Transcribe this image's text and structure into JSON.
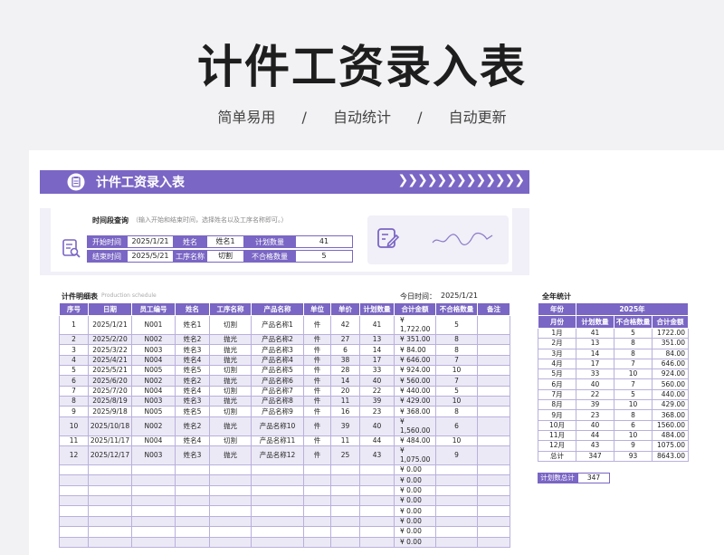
{
  "hero": {
    "title": "计件工资录入表",
    "sub": [
      "简单易用",
      "/",
      "自动统计",
      "/",
      "自动更新"
    ]
  },
  "banner": {
    "title": "计件工资录入表",
    "arrows": "❯❯❯❯❯❯❯❯❯❯❯❯❯"
  },
  "query": {
    "label": "时间段查询",
    "hint": "（输入开始和结束时间，选择姓名以及工序名称即可。）",
    "start_label": "开始时间",
    "start_value": "2025/1/21",
    "end_label": "结束时间",
    "end_value": "2025/5/21",
    "name_label": "姓名",
    "name_value": "姓名1",
    "process_label": "工序名称",
    "process_value": "切割",
    "plan_label": "计划数量",
    "plan_value": "41",
    "defect_label": "不合格数量",
    "defect_value": "5"
  },
  "detail": {
    "title": "计件明细表",
    "title_en": "Production schedule",
    "today_label": "今日时间：",
    "today_value": "2025/1/21",
    "headers": [
      "序号",
      "日期",
      "员工编号",
      "姓名",
      "工序名称",
      "产品名称",
      "单位",
      "单价",
      "计划数量",
      "合计金额",
      "不合格数量",
      "备注"
    ],
    "rows": [
      [
        "1",
        "2025/1/21",
        "N001",
        "姓名1",
        "切割",
        "产品名称1",
        "件",
        "42",
        "41",
        "¥ 1,722.00",
        "5",
        ""
      ],
      [
        "2",
        "2025/2/20",
        "N002",
        "姓名2",
        "抛光",
        "产品名称2",
        "件",
        "27",
        "13",
        "¥ 351.00",
        "8",
        ""
      ],
      [
        "3",
        "2025/3/22",
        "N003",
        "姓名3",
        "抛光",
        "产品名称3",
        "件",
        "6",
        "14",
        "¥ 84.00",
        "8",
        ""
      ],
      [
        "4",
        "2025/4/21",
        "N004",
        "姓名4",
        "抛光",
        "产品名称4",
        "件",
        "38",
        "17",
        "¥ 646.00",
        "7",
        ""
      ],
      [
        "5",
        "2025/5/21",
        "N005",
        "姓名5",
        "切割",
        "产品名称5",
        "件",
        "28",
        "33",
        "¥ 924.00",
        "10",
        ""
      ],
      [
        "6",
        "2025/6/20",
        "N002",
        "姓名2",
        "抛光",
        "产品名称6",
        "件",
        "14",
        "40",
        "¥ 560.00",
        "7",
        ""
      ],
      [
        "7",
        "2025/7/20",
        "N004",
        "姓名4",
        "切割",
        "产品名称7",
        "件",
        "20",
        "22",
        "¥ 440.00",
        "5",
        ""
      ],
      [
        "8",
        "2025/8/19",
        "N003",
        "姓名3",
        "抛光",
        "产品名称8",
        "件",
        "11",
        "39",
        "¥ 429.00",
        "10",
        ""
      ],
      [
        "9",
        "2025/9/18",
        "N005",
        "姓名5",
        "切割",
        "产品名称9",
        "件",
        "16",
        "23",
        "¥ 368.00",
        "8",
        ""
      ],
      [
        "10",
        "2025/10/18",
        "N002",
        "姓名2",
        "抛光",
        "产品名称10",
        "件",
        "39",
        "40",
        "¥ 1,560.00",
        "6",
        ""
      ],
      [
        "11",
        "2025/11/17",
        "N004",
        "姓名4",
        "切割",
        "产品名称11",
        "件",
        "11",
        "44",
        "¥ 484.00",
        "10",
        ""
      ],
      [
        "12",
        "2025/12/17",
        "N003",
        "姓名3",
        "抛光",
        "产品名称12",
        "件",
        "25",
        "43",
        "¥ 1,075.00",
        "9",
        ""
      ]
    ],
    "empty_amount": "¥ 0.00",
    "empty_rows": 8
  },
  "year": {
    "title": "全年统计",
    "col_year": "年份",
    "year_value": "2025年",
    "headers": [
      "月份",
      "计划数量",
      "不合格数量",
      "合计金额"
    ],
    "rows": [
      [
        "1月",
        "41",
        "5",
        "1722.00"
      ],
      [
        "2月",
        "13",
        "8",
        "351.00"
      ],
      [
        "3月",
        "14",
        "8",
        "84.00"
      ],
      [
        "4月",
        "17",
        "7",
        "646.00"
      ],
      [
        "5月",
        "33",
        "10",
        "924.00"
      ],
      [
        "6月",
        "40",
        "7",
        "560.00"
      ],
      [
        "7月",
        "22",
        "5",
        "440.00"
      ],
      [
        "8月",
        "39",
        "10",
        "429.00"
      ],
      [
        "9月",
        "23",
        "8",
        "368.00"
      ],
      [
        "10月",
        "40",
        "6",
        "1560.00"
      ],
      [
        "11月",
        "44",
        "10",
        "484.00"
      ],
      [
        "12月",
        "43",
        "9",
        "1075.00"
      ],
      [
        "总计",
        "347",
        "93",
        "8643.00"
      ]
    ],
    "total_label": "计划数总计",
    "total_value": "347"
  },
  "colors": {
    "accent": "#7a66c4",
    "stripe": "#ece9f6",
    "panel": "#f1eff7"
  }
}
